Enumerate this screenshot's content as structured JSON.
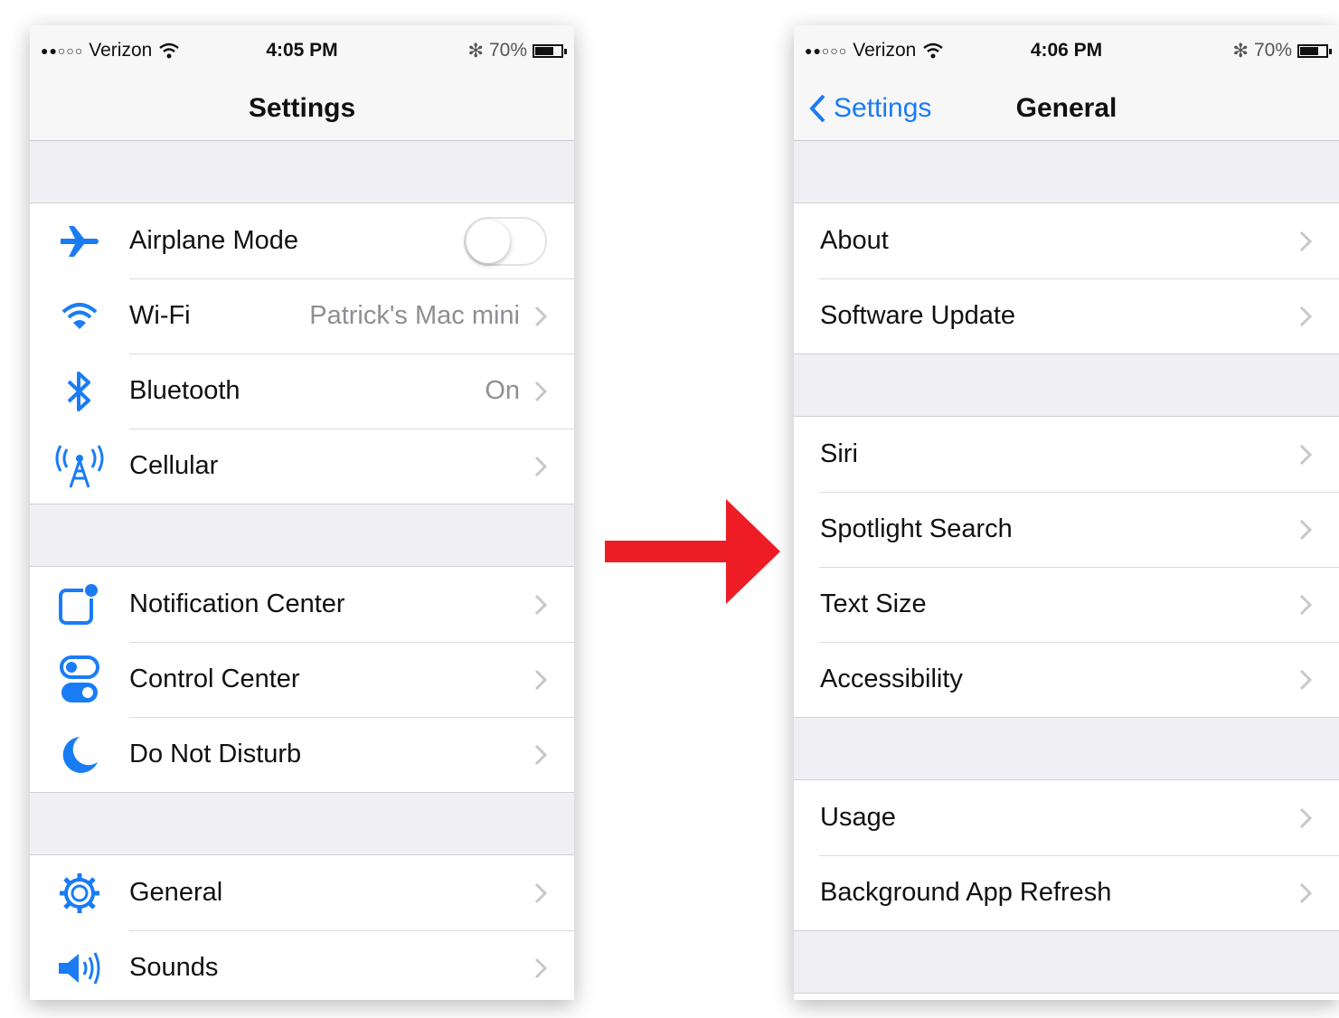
{
  "colors": {
    "accent": "#1a7cf5",
    "arrow": "#ee1c25",
    "background": "#efeff4"
  },
  "left": {
    "status": {
      "carrier": "Verizon",
      "time": "4:05 PM",
      "battery": "70%",
      "battery_level": 0.7
    },
    "nav_title": "Settings",
    "group1": [
      {
        "icon": "airplane-icon",
        "label": "Airplane Mode",
        "toggle_on": false
      },
      {
        "icon": "wifi-icon",
        "label": "Wi-Fi",
        "value": "Patrick's Mac mini"
      },
      {
        "icon": "bluetooth-icon",
        "label": "Bluetooth",
        "value": "On"
      },
      {
        "icon": "cellular-icon",
        "label": "Cellular"
      }
    ],
    "group2": [
      {
        "icon": "notification-center-icon",
        "label": "Notification Center"
      },
      {
        "icon": "control-center-icon",
        "label": "Control Center"
      },
      {
        "icon": "moon-icon",
        "label": "Do Not Disturb"
      }
    ],
    "group3": [
      {
        "icon": "gear-icon",
        "label": "General"
      },
      {
        "icon": "speaker-icon",
        "label": "Sounds"
      }
    ]
  },
  "right": {
    "status": {
      "carrier": "Verizon",
      "time": "4:06 PM",
      "battery": "70%",
      "battery_level": 0.7
    },
    "back_label": "Settings",
    "nav_title": "General",
    "group1": [
      {
        "label": "About"
      },
      {
        "label": "Software Update"
      }
    ],
    "group2": [
      {
        "label": "Siri"
      },
      {
        "label": "Spotlight Search"
      },
      {
        "label": "Text Size"
      },
      {
        "label": "Accessibility"
      }
    ],
    "group3": [
      {
        "label": "Usage"
      },
      {
        "label": "Background App Refresh"
      }
    ]
  }
}
